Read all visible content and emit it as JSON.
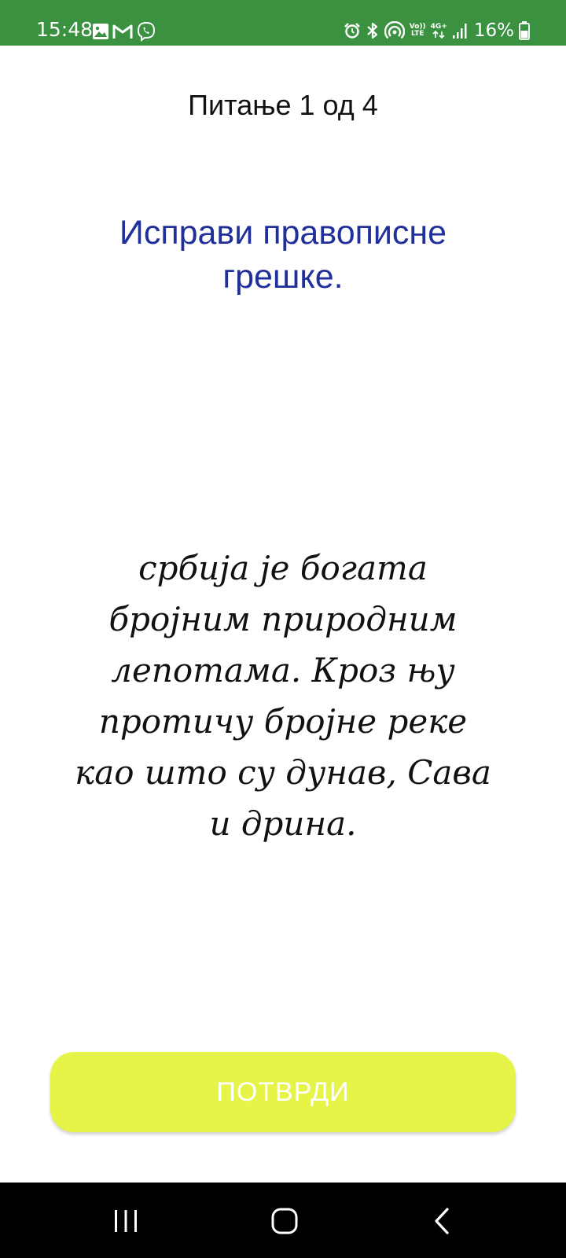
{
  "status_bar": {
    "time": "15:48",
    "battery": "16%",
    "network_top": "Vo))",
    "network_bottom": "LTE",
    "data_type": "4G+",
    "background": "#3a9140",
    "left_icons": [
      "gallery-icon",
      "gmail-icon",
      "viber-icon"
    ],
    "right_icons": [
      "alarm-icon",
      "bluetooth-icon",
      "hotspot-icon",
      "volte-icon",
      "mobile-data-icon",
      "signal-icon",
      "battery-icon"
    ]
  },
  "quiz": {
    "counter": "Питање 1 од 4",
    "title": "Исправи правописне грешке.",
    "sentence": "србија је богата бројним природним лепотама. Кроз њу протичу бројне реке као што су дунав, Сава и дрина.",
    "title_color": "#20309b"
  },
  "actions": {
    "confirm_label": "ПОТВРДИ",
    "confirm_color": "#e6f447"
  },
  "nav_bar": {
    "buttons": [
      "recent-apps-icon",
      "home-icon",
      "back-icon"
    ]
  }
}
